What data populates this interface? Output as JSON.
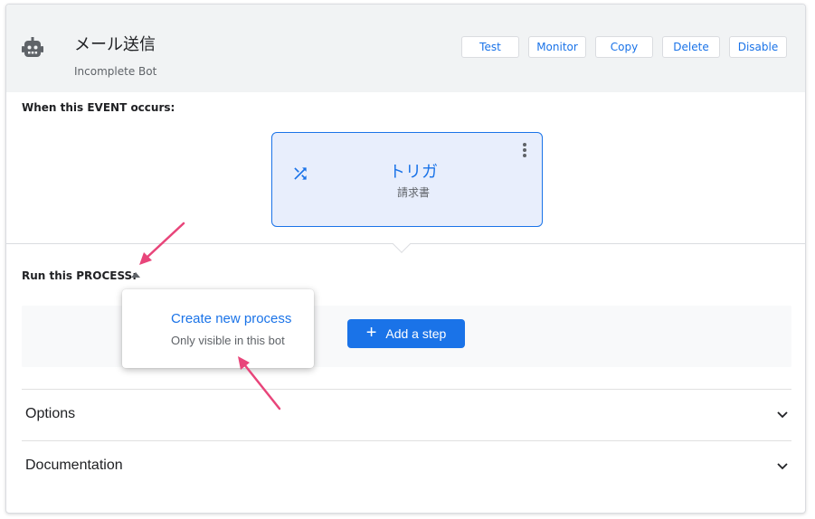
{
  "header": {
    "title": "メール送信",
    "subtitle": "Incomplete Bot",
    "buttons": {
      "test": "Test",
      "monitor": "Monitor",
      "copy": "Copy",
      "delete": "Delete",
      "disable": "Disable"
    }
  },
  "event": {
    "label": "When this EVENT occurs:",
    "trigger_title": "トリガ",
    "trigger_sub": "請求書"
  },
  "process": {
    "label": "Run this PROCESS:",
    "add_step": "Add a step",
    "popup_title": "Create new process",
    "popup_sub": "Only visible in this bot"
  },
  "sections": {
    "options": "Options",
    "documentation": "Documentation"
  },
  "colors": {
    "accent": "#1a73e8",
    "annotation_arrow": "#e8457a"
  }
}
